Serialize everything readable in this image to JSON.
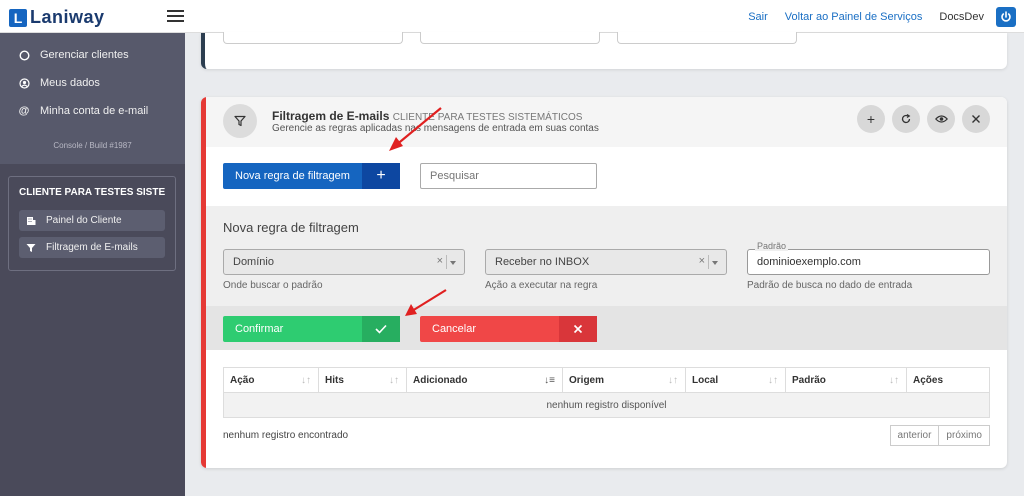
{
  "brand": {
    "logo_letter": "L",
    "logo_text": "Laniway"
  },
  "topbar": {
    "links": [
      "Sair",
      "Voltar ao Painel de Serviços"
    ],
    "user": "DocsDev"
  },
  "sidebar": {
    "items": [
      {
        "label": "Gerenciar clientes",
        "icon": "circle-icon"
      },
      {
        "label": "Meus dados",
        "icon": "user-circle-icon"
      },
      {
        "label": "Minha conta de e-mail",
        "icon": "at-icon"
      }
    ],
    "build": "Console / Build #1987",
    "client_title": "CLIENTE PARA TESTES SISTE...",
    "client_links": [
      {
        "label": "Painel do Cliente",
        "icon": "building-icon"
      },
      {
        "label": "Filtragem de E-mails",
        "icon": "filter-icon"
      }
    ]
  },
  "card": {
    "title": "Filtragem de E-mails",
    "client": "CLIENTE PARA TESTES SISTEMÁTICOS",
    "description": "Gerencie as regras aplicadas nas mensagens de entrada em suas contas",
    "header_buttons": [
      "plus-icon",
      "refresh-icon",
      "eye-icon",
      "close-icon"
    ]
  },
  "toolbar": {
    "new_rule_label": "Nova regra de filtragem",
    "search_placeholder": "Pesquisar"
  },
  "form": {
    "title": "Nova regra de filtragem",
    "where": {
      "value": "Domínio",
      "hint": "Onde buscar o padrão"
    },
    "action": {
      "value": "Receber no INBOX",
      "hint": "Ação a executar na regra"
    },
    "pattern": {
      "legend": "Padrão",
      "value": "dominioexemplo.com",
      "hint": "Padrão de busca no dado de entrada"
    },
    "confirm_label": "Confirmar",
    "cancel_label": "Cancelar"
  },
  "table": {
    "columns": [
      "Ação",
      "Hits",
      "Adicionado",
      "Origem",
      "Local",
      "Padrão",
      "Ações"
    ],
    "empty_text": "nenhum registro disponível",
    "footer": "nenhum registro encontrado",
    "prev": "anterior",
    "next": "próximo"
  },
  "colors": {
    "primary": "#1565c0",
    "confirm": "#2ecc71",
    "cancel": "#f04747",
    "accent": "#e53935",
    "sidebar": "#4a4a5a"
  }
}
